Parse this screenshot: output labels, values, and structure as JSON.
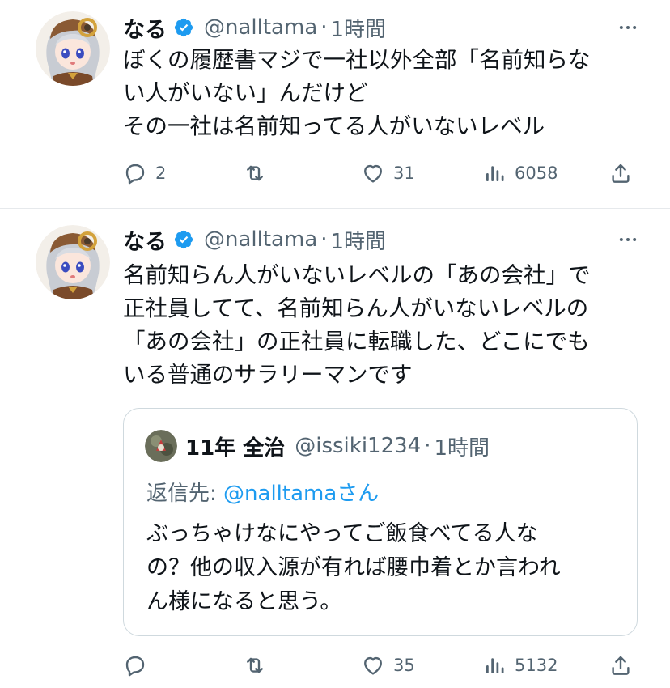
{
  "tweets": [
    {
      "author": {
        "name": "なる",
        "handle": "@nalltama",
        "time": "1時間",
        "verified": true
      },
      "text_lines": [
        "ぼくの履歴書マジで一社以外全部「名前知らな",
        "い人がいない」んだけど",
        "その一社は名前知ってる人がいないレベル"
      ],
      "actions": {
        "reply": "2",
        "retweet": "",
        "like": "31",
        "views": "6058"
      }
    },
    {
      "author": {
        "name": "なる",
        "handle": "@nalltama",
        "time": "1時間",
        "verified": true
      },
      "text_lines": [
        "名前知らん人がいないレベルの「あの会社」で",
        "正社員してて、名前知らん人がいないレベルの",
        "「あの会社」の正社員に転職した、どこにでも",
        "いる普通のサラリーマンです"
      ],
      "quote": {
        "author": {
          "name": "11年 全治",
          "handle": "@issiki1234",
          "time": "1時間"
        },
        "reply_prefix": "返信先: ",
        "reply_to": "@nalltama",
        "reply_suffix": "さん",
        "text_lines": [
          "ぶっちゃけなにやってご飯食べてる人な",
          "の？他の収入源が有れば腰巾着とか言われ",
          "ん様になると思う。"
        ]
      },
      "actions": {
        "reply": "",
        "retweet": "",
        "like": "35",
        "views": "5132"
      }
    }
  ],
  "icons": {
    "verified": "verified-badge-icon",
    "more": "more-dots-icon",
    "reply": "reply-bubble-icon",
    "retweet": "retweet-icon",
    "like": "heart-icon",
    "views": "views-bar-icon",
    "share": "share-upload-icon"
  },
  "colors": {
    "verified": "#1d9bf0",
    "mention": "#1d9bf0",
    "muted": "#536471",
    "text": "#0f1419"
  }
}
